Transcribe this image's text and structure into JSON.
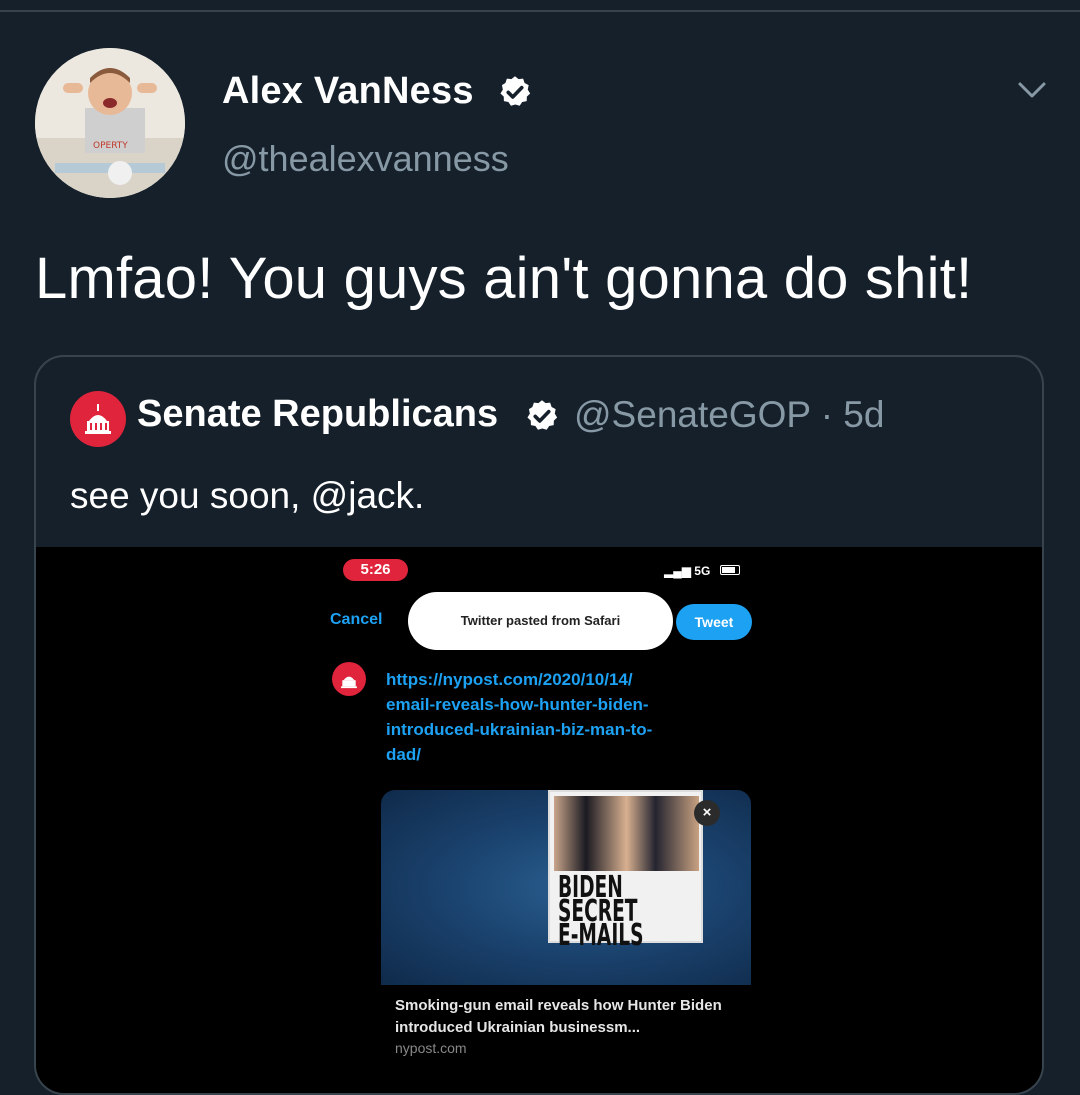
{
  "tweet": {
    "author_name": "Alex VanNess",
    "author_handle": "@thealexvanness",
    "text": "Lmfao! You guys ain't gonna do shit!"
  },
  "quoted_tweet": {
    "author_name": "Senate Republicans",
    "author_handle": "@SenateGOP",
    "separator": "·",
    "age": "5d",
    "text": "see you soon, @jack."
  },
  "media": {
    "status_time": "5:26",
    "network": "5G",
    "cancel_label": "Cancel",
    "paste_banner": "Twitter pasted from Safari",
    "tweet_button": "Tweet",
    "url_lines": [
      "https://nypost.com/2020/10/14/",
      "email-reveals-how-hunter-biden-",
      "introduced-ukrainian-biz-man-to-",
      "dad/"
    ],
    "link_card": {
      "headline_lines": [
        "BIDEN",
        "SECRET",
        "E-MAILS"
      ],
      "title": "Smoking-gun email reveals how Hunter Biden introduced Ukrainian businessm...",
      "domain": "nypost.com"
    }
  },
  "colors": {
    "background": "#15202b",
    "secondary_text": "#8899a6",
    "accent_blue": "#1da1f2",
    "senate_red": "#e0243b"
  },
  "icons": [
    "verified-badge-icon",
    "chevron-down-icon",
    "capitol-icon",
    "close-icon"
  ]
}
